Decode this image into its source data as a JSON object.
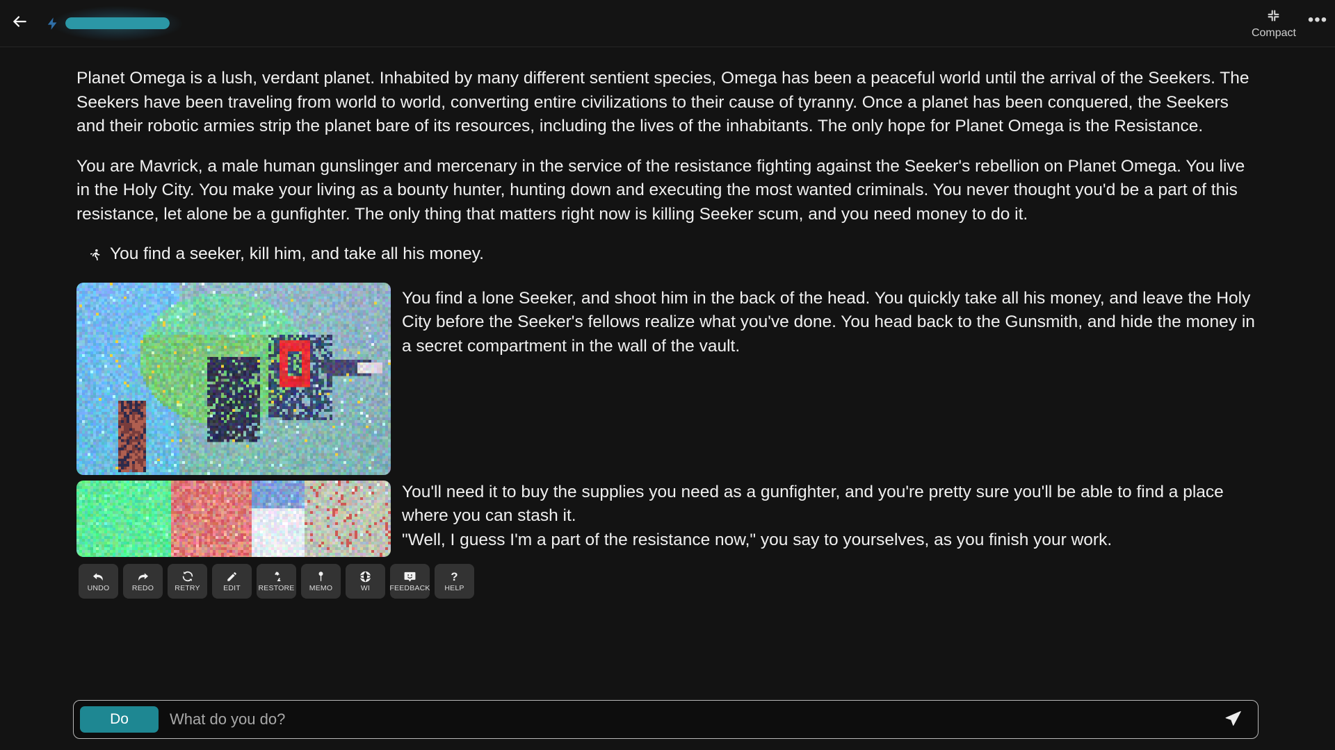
{
  "header": {
    "back_icon": "arrow-left-icon",
    "energy_icon": "lightning-bolt-icon",
    "progress": {
      "value": 100,
      "accent_color": "#2b97a6",
      "glow_color": "#3aa0b4"
    },
    "compact_label": "Compact",
    "compact_icon": "compact-collapse-icon",
    "menu_icon": "more-options-icon",
    "menu_glyph": "•••"
  },
  "story": {
    "paragraphs": [
      "Planet Omega is a lush, verdant planet. Inhabited by many different sentient species, Omega has been a peaceful world until the arrival of the Seekers. The Seekers have been traveling from world to world, converting entire civilizations to their cause of tyranny. Once a planet has been conquered, the Seekers and their robotic armies strip the planet bare of its resources, including the lives of the inhabitants. The only hope for Planet Omega is the Resistance.",
      "You are Mavrick, a male human gunslinger and mercenary in the service of the resistance fighting against the Seeker's rebellion on Planet Omega. You live in the Holy City. You make your living as a bounty hunter, hunting down and executing the most wanted criminals. You never thought you'd be a part of this resistance, let alone be a gunfighter. The only thing that matters right now is killing Seeker scum, and you need money to do it."
    ],
    "action": {
      "icon": "running-person-icon",
      "text": "You find a seeker, kill him, and take all his money."
    },
    "block_a_text": "You find a lone Seeker, and shoot him in the back of the head. You quickly take all his money, and leave the Holy City before the Seeker's fellows realize what you've done. You head back to the Gunsmith, and hide the money in a secret compartment in the wall of the vault.",
    "block_b_text_1": " You'll need it to buy the supplies you need as a gunfighter, and you're pretty sure you'll be able to find a place where you can stash it.",
    "block_b_text_2": "\"Well, I guess I'm a part of the resistance now,\" you say to yourselves, as you finish your work.",
    "images": [
      {
        "name": "generated-scene-image-1",
        "alt": "pixelated scene of a green and blue alien world with a figure"
      },
      {
        "name": "generated-scene-image-2",
        "alt": "pixelated scene with green foliage and red structures"
      }
    ]
  },
  "toolbar": {
    "buttons": [
      {
        "label": "UNDO",
        "icon": "undo-arrow-icon"
      },
      {
        "label": "REDO",
        "icon": "redo-arrow-icon"
      },
      {
        "label": "RETRY",
        "icon": "refresh-icon"
      },
      {
        "label": "EDIT",
        "icon": "pencil-icon"
      },
      {
        "label": "RESTORE",
        "icon": "recycle-icon"
      },
      {
        "label": "MEMO",
        "icon": "pin-icon"
      },
      {
        "label": "WI",
        "icon": "globe-icon"
      },
      {
        "label": "FEEDBACK",
        "icon": "smiley-chat-icon"
      },
      {
        "label": "HELP",
        "icon": "question-mark-icon"
      }
    ]
  },
  "input": {
    "mode_label": "Do",
    "mode_color": "#1e8792",
    "placeholder": "What do you do?",
    "value": "",
    "send_icon": "send-paper-plane-icon"
  }
}
